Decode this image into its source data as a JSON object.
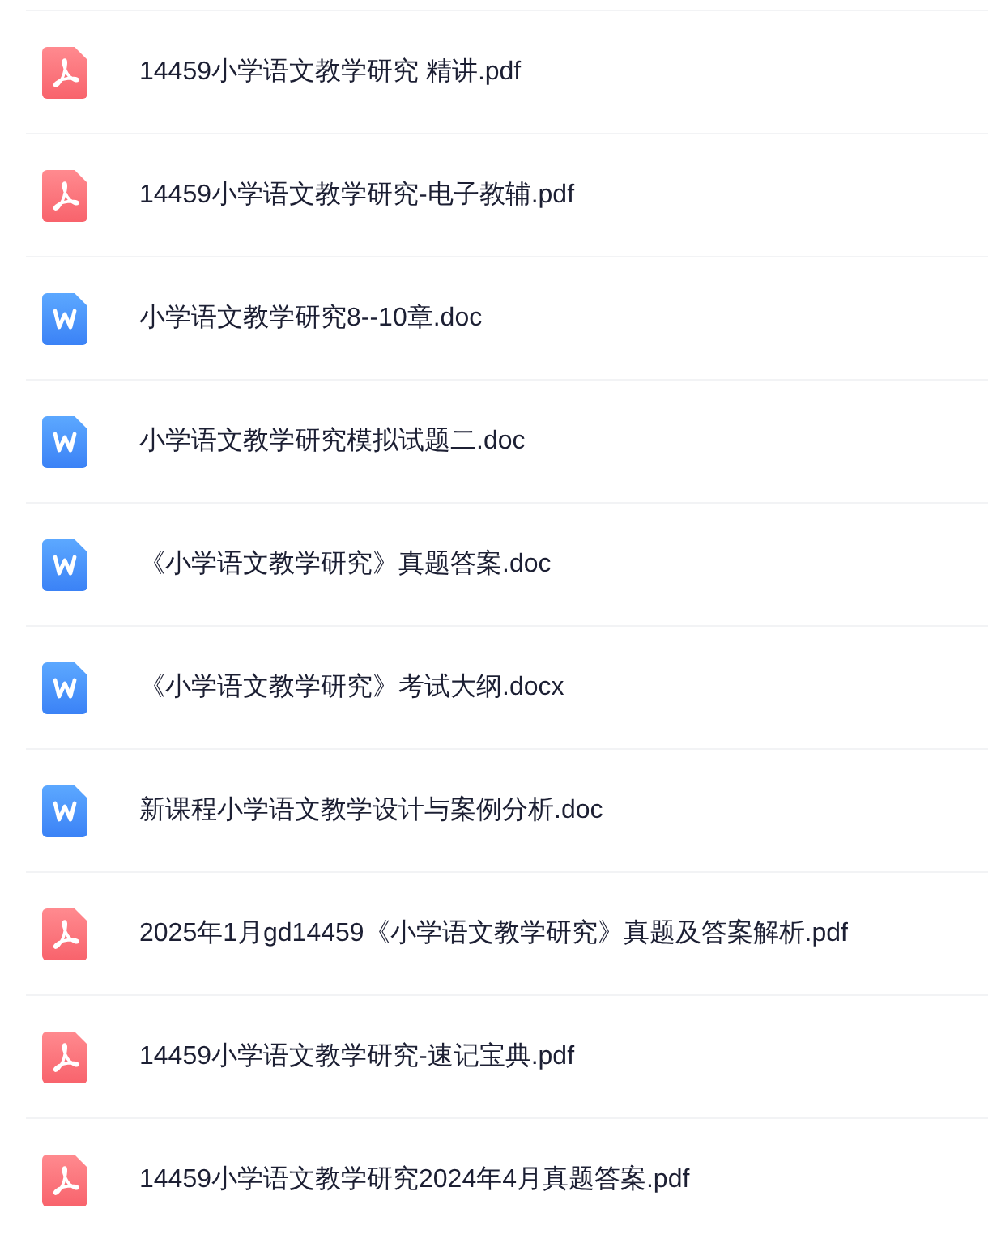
{
  "files": [
    {
      "kind": "pdf",
      "name": "14459小学语文教学研究 精讲.pdf"
    },
    {
      "kind": "pdf",
      "name": "14459小学语文教学研究-电子教辅.pdf"
    },
    {
      "kind": "doc",
      "name": "小学语文教学研究8--10章.doc"
    },
    {
      "kind": "doc",
      "name": "小学语文教学研究模拟试题二.doc"
    },
    {
      "kind": "doc",
      "name": "《小学语文教学研究》真题答案.doc"
    },
    {
      "kind": "doc",
      "name": "《小学语文教学研究》考试大纲.docx"
    },
    {
      "kind": "doc",
      "name": "新课程小学语文教学设计与案例分析.doc"
    },
    {
      "kind": "pdf",
      "name": "2025年1月gd14459《小学语文教学研究》真题及答案解析.pdf"
    },
    {
      "kind": "pdf",
      "name": "14459小学语文教学研究-速记宝典.pdf"
    },
    {
      "kind": "pdf",
      "name": "14459小学语文教学研究2024年4月真题答案.pdf"
    }
  ]
}
